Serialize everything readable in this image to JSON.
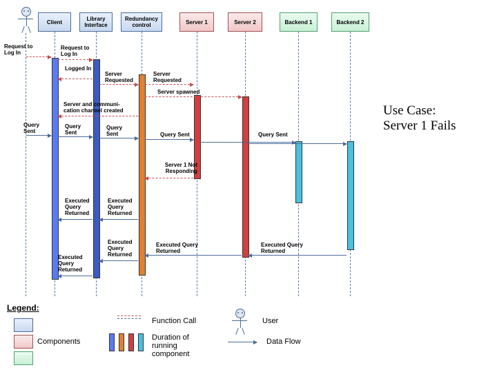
{
  "title_line1": "Use Case:",
  "title_line2": " Server 1 Fails",
  "participants": {
    "client": "Client",
    "library": "Library Interface",
    "redundancy": "Redundancy control",
    "server1": "Server 1",
    "server2": "Server 2",
    "backend1": "Backend 1",
    "backend2": "Backend 2"
  },
  "messages": {
    "request_login_1": "Request to Log In",
    "request_login_2": "Request to Log In",
    "logged_in": "Logged In",
    "server_requested_1": "Server Requested",
    "server_requested_2": "Server Requested",
    "server_spawned": "Server spawned",
    "channel_created": "Server and communi-\ncation channel created",
    "query_sent_1": "Query Sent",
    "query_sent_2": "Query Sent",
    "query_sent_3": "Query Sent",
    "query_sent_4": "Query Sent",
    "query_sent_5": "Query Sent",
    "server1_not_responding": "Server 1 Not Responding",
    "exec_returned_1": "Executed Query Returned",
    "exec_returned_2": "Executed Query Returned",
    "exec_returned_3": "Executed Query Returned",
    "exec_returned_4": "Executed Query Returned",
    "exec_returned_5": "Executed Query Returned",
    "exec_returned_6": "Executed Query Returned"
  },
  "legend": {
    "heading": "Legend:",
    "components": "Components",
    "function_call": "Function Call",
    "duration": "Duration of running component",
    "user": "User",
    "data_flow": "Data Flow"
  }
}
